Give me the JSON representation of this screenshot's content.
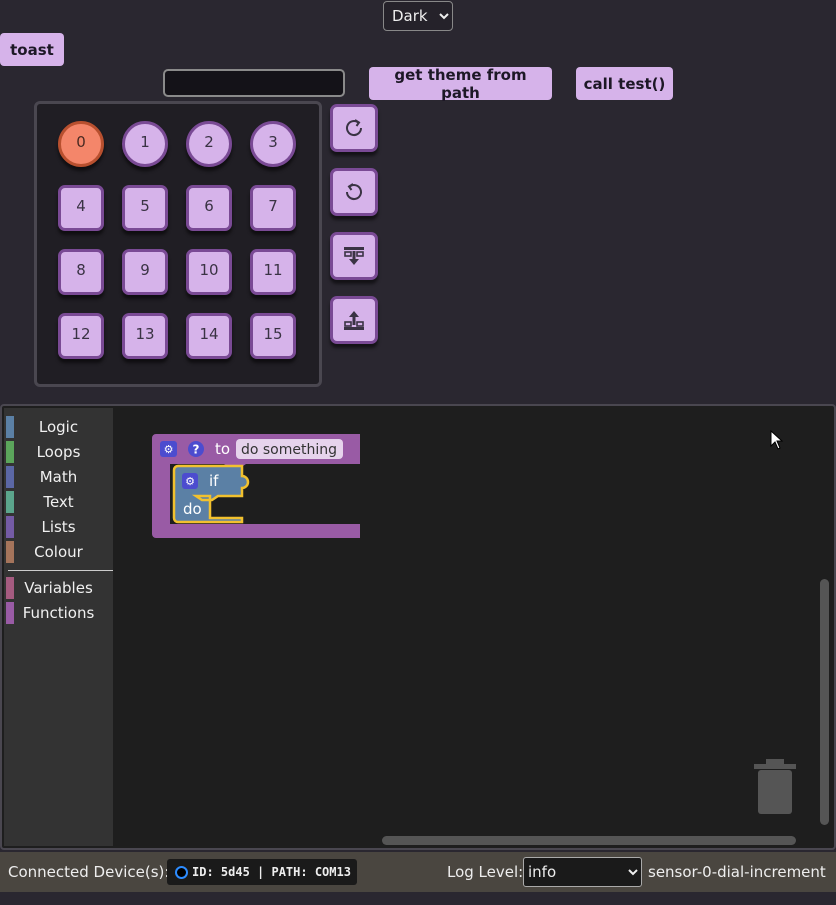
{
  "header": {
    "theme_selected": "Dark",
    "toast_label": "toast",
    "path_input_value": "",
    "theme_path_label": "get theme from path",
    "call_test_label": "call test()"
  },
  "keys": [
    "0",
    "1",
    "2",
    "3",
    "4",
    "5",
    "6",
    "7",
    "8",
    "9",
    "10",
    "11",
    "12",
    "13",
    "14",
    "15"
  ],
  "side_buttons": [
    "rotate-cw-icon",
    "rotate-ccw-icon",
    "download-tray-icon",
    "upload-tray-icon"
  ],
  "toolbox": {
    "categories": [
      {
        "label": "Logic",
        "color": "#5b80a5"
      },
      {
        "label": "Loops",
        "color": "#5ba55b"
      },
      {
        "label": "Math",
        "color": "#5b67a5"
      },
      {
        "label": "Text",
        "color": "#5ba58c"
      },
      {
        "label": "Lists",
        "color": "#745ba5"
      },
      {
        "label": "Colour",
        "color": "#a5745b"
      },
      {
        "label": "Variables",
        "color": "#a55b80"
      },
      {
        "label": "Functions",
        "color": "#995ba5"
      }
    ]
  },
  "blocks": {
    "func_to": "to",
    "func_name": "do something",
    "if_label": "if",
    "do_label": "do"
  },
  "status": {
    "devices_label": "Connected Device(s):",
    "device_id": "ID: 5d45 | PATH: COM13",
    "log_label": "Log Level:",
    "log_level": "info",
    "event_text": "sensor-0-dial-increment"
  }
}
